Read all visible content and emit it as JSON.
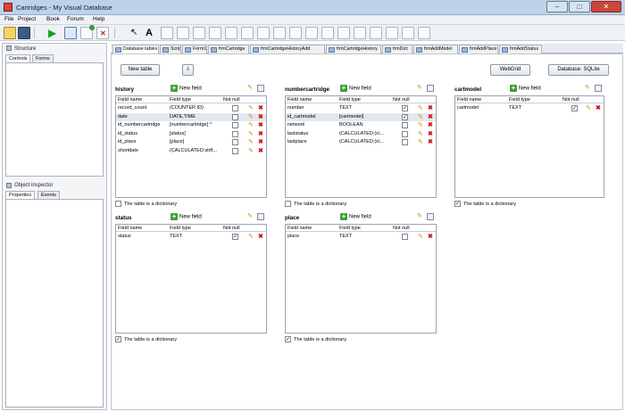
{
  "window": {
    "title": "Cartridges - My Visual Database"
  },
  "menu": [
    "File",
    "Project",
    "Book",
    "Forum",
    "Help"
  ],
  "left": {
    "structure_label": "Structure",
    "tabs_top": [
      "Controls",
      "Forms"
    ],
    "inspector_label": "Object inspector",
    "tabs_bottom": [
      "Properties",
      "Events"
    ]
  },
  "tabs": [
    {
      "label": "Database tables",
      "selected": true
    },
    {
      "label": "Script"
    },
    {
      "label": "Form1"
    },
    {
      "label": "frmCartridge"
    },
    {
      "label": "frmCartridgeHistoryAdd"
    },
    {
      "label": "frmCartridgeHistory"
    },
    {
      "label": "frmDict"
    },
    {
      "label": "frmAddModel"
    },
    {
      "label": "frmAddPlace"
    },
    {
      "label": "frmAddStatus"
    }
  ],
  "buttons": {
    "new_table": "New table",
    "webgrid": "WebGrid",
    "database": "Database: SQLite"
  },
  "columns": {
    "name": "Field name",
    "type": "Field type",
    "notnull": "Not null"
  },
  "new_field_label": "New field",
  "dictionary_label": "The table is a dictionary",
  "db_tables": [
    {
      "name": "history",
      "rows": [
        {
          "name": "record_count",
          "type": "(COUNTER ID)",
          "notnull": false
        },
        {
          "name": "date",
          "type": "DATE,TIME",
          "notnull": false
        },
        {
          "name": "id_numbercartridge",
          "type": "[numbercartridge] ^",
          "notnull": false
        },
        {
          "name": "id_status",
          "type": "[status]",
          "notnull": false
        },
        {
          "name": "id_place",
          "type": "[place]",
          "notnull": false
        },
        {
          "name": "shortdate",
          "type": "(CALCULATED:strft...",
          "notnull": false
        }
      ],
      "dictionary": false
    },
    {
      "name": "numbercartridge",
      "rows": [
        {
          "name": "number",
          "type": "TEXT",
          "notnull": true
        },
        {
          "name": "id_cartmodel",
          "type": "[cartmodel]",
          "notnull": true
        },
        {
          "name": "network",
          "type": "BOOLEAN",
          "notnull": false
        },
        {
          "name": "laststatus",
          "type": "(CALCULATED:(s\\...",
          "notnull": false
        },
        {
          "name": "lastplace",
          "type": "(CALCULATED:(s\\...",
          "notnull": false
        }
      ],
      "dictionary": false
    },
    {
      "name": "cartmodel",
      "rows": [
        {
          "name": "cartmodel",
          "type": "TEXT",
          "notnull": true
        }
      ],
      "dictionary": true
    },
    {
      "name": "status",
      "rows": [
        {
          "name": "status",
          "type": "TEXT",
          "notnull": true
        }
      ],
      "dictionary": true
    },
    {
      "name": "place",
      "rows": [
        {
          "name": "place",
          "type": "TEXT",
          "notnull": false
        }
      ],
      "dictionary": true
    }
  ]
}
